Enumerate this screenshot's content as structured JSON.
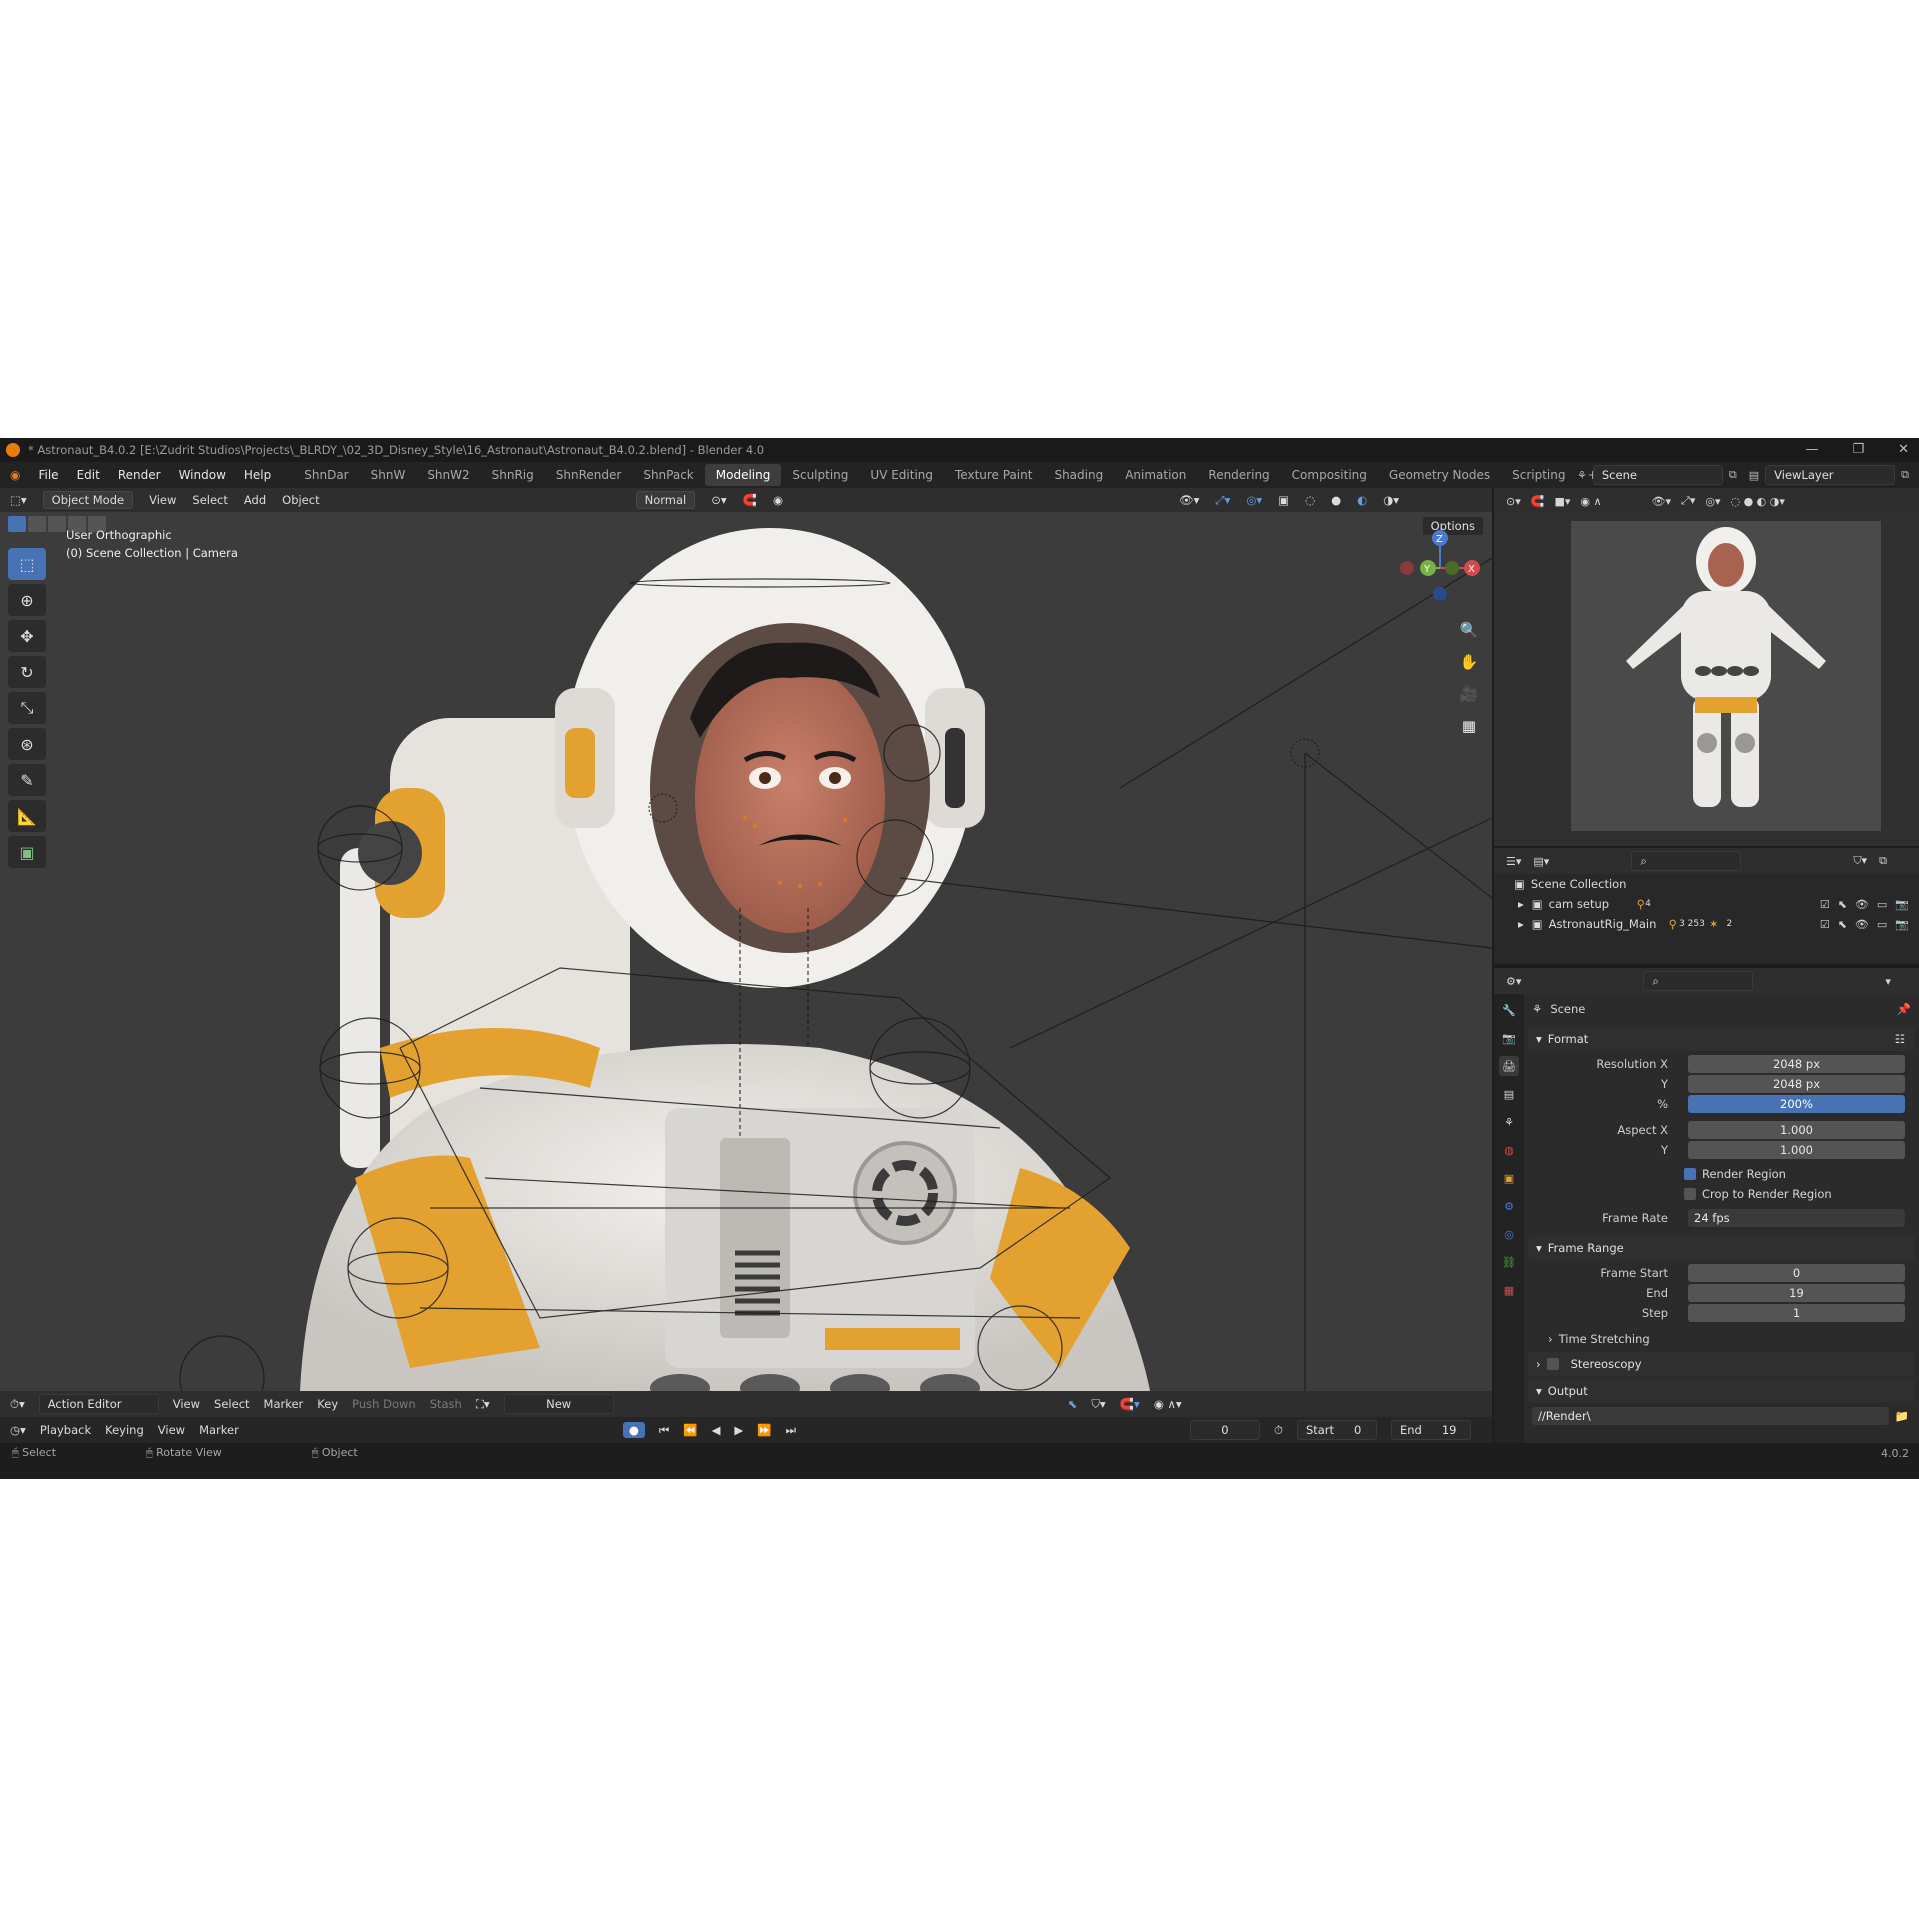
{
  "window": {
    "title": "* Astronaut_B4.0.2 [E:\\Zudrit Studios\\Projects\\_BLRDY_\\02_3D_Disney_Style\\16_Astronaut\\Astronaut_B4.0.2.blend] - Blender 4.0",
    "controls": [
      "—",
      "❐",
      "✕"
    ]
  },
  "menu": [
    "File",
    "Edit",
    "Render",
    "Window",
    "Help"
  ],
  "workspaces": [
    "ShnDar",
    "ShnW",
    "ShnW2",
    "ShnRig",
    "ShnRender",
    "ShnPack",
    "Modeling",
    "Sculpting",
    "UV Editing",
    "Texture Paint",
    "Shading",
    "Animation",
    "Rendering",
    "Compositing",
    "Geometry Nodes",
    "Scripting",
    "+"
  ],
  "active_workspace": "Modeling",
  "scene_selector": "Scene",
  "viewlayer_selector": "ViewLayer",
  "viewport": {
    "mode": "Object Mode",
    "menus": [
      "View",
      "Select",
      "Add",
      "Object"
    ],
    "orientation": "Normal",
    "options": "Options",
    "info_line1": "User Orthographic",
    "info_line2": "(0) Scene Collection | Camera",
    "gizmo_axes": [
      "Z",
      "Y",
      "X"
    ]
  },
  "action_editor": {
    "mode": "Action Editor",
    "menus": [
      "View",
      "Select",
      "Marker",
      "Key"
    ],
    "push_down": "Push Down",
    "stash": "Stash",
    "new": "New"
  },
  "timeline": {
    "menus": [
      "Playback",
      "Keying",
      "View",
      "Marker"
    ],
    "current_frame": "0",
    "start_label": "Start",
    "start": "0",
    "end_label": "End",
    "end": "19"
  },
  "status": {
    "select": "Select",
    "rotate": "Rotate View",
    "object": "Object",
    "version": "4.0.2"
  },
  "outliner": {
    "root": "Scene Collection",
    "rows": [
      {
        "name": "cam setup",
        "badge": "4"
      },
      {
        "name": "AstronautRig_Main",
        "badge": "3 253",
        "badge2": "2"
      }
    ]
  },
  "properties": {
    "context": "Scene",
    "format_title": "Format",
    "res_x_label": "Resolution X",
    "res_x": "2048 px",
    "res_y_label": "Y",
    "res_y": "2048 px",
    "pct_label": "%",
    "pct": "200%",
    "aspect_x_label": "Aspect X",
    "aspect_x": "1.000",
    "aspect_y_label": "Y",
    "aspect_y": "1.000",
    "render_region": "Render Region",
    "crop_region": "Crop to Render Region",
    "frame_rate_label": "Frame Rate",
    "frame_rate": "24 fps",
    "frame_range_title": "Frame Range",
    "frame_start_label": "Frame Start",
    "frame_start": "0",
    "end_label": "End",
    "end": "19",
    "step_label": "Step",
    "step": "1",
    "time_stretching": "Time Stretching",
    "stereoscopy": "Stereoscopy",
    "output_title": "Output",
    "output_path": "//Render\\"
  }
}
